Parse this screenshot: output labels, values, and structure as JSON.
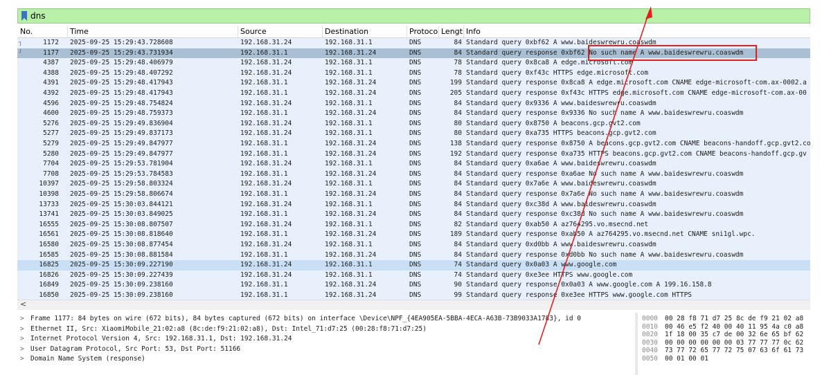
{
  "filter": {
    "value": "dns",
    "icon": "bookmark-icon",
    "bg_color": "#b8f0a8"
  },
  "columns": {
    "no": "No.",
    "time": "Time",
    "source": "Source",
    "destination": "Destination",
    "protocol": "Protoco",
    "length": "Lengt",
    "info": "Info"
  },
  "packets": [
    {
      "no": "1172",
      "time": "2025-09-25 15:29:43.728608",
      "src": "192.168.31.24",
      "dst": "192.168.31.1",
      "proto": "DNS",
      "len": "84",
      "info": "Standard query 0xbf62 A www.baideswrewru.coaswdm"
    },
    {
      "no": "1177",
      "time": "2025-09-25 15:29:43.731934",
      "src": "192.168.31.1",
      "dst": "192.168.31.24",
      "proto": "DNS",
      "len": "84",
      "info": "Standard query response 0xbf62 No such name A www.baideswrewru.coaswdm"
    },
    {
      "no": "4387",
      "time": "2025-09-25 15:29:48.406979",
      "src": "192.168.31.24",
      "dst": "192.168.31.1",
      "proto": "DNS",
      "len": "78",
      "info": "Standard query 0x8ca8 A edge.microsoft.com"
    },
    {
      "no": "4388",
      "time": "2025-09-25 15:29:48.407292",
      "src": "192.168.31.24",
      "dst": "192.168.31.1",
      "proto": "DNS",
      "len": "78",
      "info": "Standard query 0xf43c HTTPS edge.microsoft.com"
    },
    {
      "no": "4391",
      "time": "2025-09-25 15:29:48.417943",
      "src": "192.168.31.1",
      "dst": "192.168.31.24",
      "proto": "DNS",
      "len": "199",
      "info": "Standard query response 0x8ca8 A edge.microsoft.com CNAME edge-microsoft-com.ax-0002.a"
    },
    {
      "no": "4392",
      "time": "2025-09-25 15:29:48.417943",
      "src": "192.168.31.1",
      "dst": "192.168.31.24",
      "proto": "DNS",
      "len": "205",
      "info": "Standard query response 0xf43c HTTPS edge.microsoft.com CNAME edge-microsoft-com.ax-00"
    },
    {
      "no": "4596",
      "time": "2025-09-25 15:29:48.754824",
      "src": "192.168.31.24",
      "dst": "192.168.31.1",
      "proto": "DNS",
      "len": "84",
      "info": "Standard query 0x9336 A www.baideswrewru.coaswdm"
    },
    {
      "no": "4600",
      "time": "2025-09-25 15:29:48.759373",
      "src": "192.168.31.1",
      "dst": "192.168.31.24",
      "proto": "DNS",
      "len": "84",
      "info": "Standard query response 0x9336 No such name A www.baideswrewru.coaswdm"
    },
    {
      "no": "5276",
      "time": "2025-09-25 15:29:49.836904",
      "src": "192.168.31.24",
      "dst": "192.168.31.1",
      "proto": "DNS",
      "len": "80",
      "info": "Standard query 0x8750 A beacons.gcp.gvt2.com"
    },
    {
      "no": "5277",
      "time": "2025-09-25 15:29:49.837173",
      "src": "192.168.31.24",
      "dst": "192.168.31.1",
      "proto": "DNS",
      "len": "80",
      "info": "Standard query 0xa735 HTTPS beacons.gcp.gvt2.com"
    },
    {
      "no": "5279",
      "time": "2025-09-25 15:29:49.847977",
      "src": "192.168.31.1",
      "dst": "192.168.31.24",
      "proto": "DNS",
      "len": "138",
      "info": "Standard query response 0x8750 A beacons.gcp.gvt2.com CNAME beacons-handoff.gcp.gvt2.com"
    },
    {
      "no": "5280",
      "time": "2025-09-25 15:29:49.847977",
      "src": "192.168.31.1",
      "dst": "192.168.31.24",
      "proto": "DNS",
      "len": "192",
      "info": "Standard query response 0xa735 HTTPS beacons.gcp.gvt2.com CNAME beacons-handoff.gcp.gv"
    },
    {
      "no": "7704",
      "time": "2025-09-25 15:29:53.781904",
      "src": "192.168.31.24",
      "dst": "192.168.31.1",
      "proto": "DNS",
      "len": "84",
      "info": "Standard query 0xa6ae A www.baideswrewru.coaswdm"
    },
    {
      "no": "7708",
      "time": "2025-09-25 15:29:53.784583",
      "src": "192.168.31.1",
      "dst": "192.168.31.24",
      "proto": "DNS",
      "len": "84",
      "info": "Standard query response 0xa6ae No such name A www.baideswrewru.coaswdm"
    },
    {
      "no": "10397",
      "time": "2025-09-25 15:29:58.803324",
      "src": "192.168.31.24",
      "dst": "192.168.31.1",
      "proto": "DNS",
      "len": "84",
      "info": "Standard query 0x7a6e A www.baideswrewru.coaswdm"
    },
    {
      "no": "10398",
      "time": "2025-09-25 15:29:58.806674",
      "src": "192.168.31.1",
      "dst": "192.168.31.24",
      "proto": "DNS",
      "len": "84",
      "info": "Standard query response 0x7a6e No such name A www.baideswrewru.coaswdm"
    },
    {
      "no": "13733",
      "time": "2025-09-25 15:30:03.844121",
      "src": "192.168.31.24",
      "dst": "192.168.31.1",
      "proto": "DNS",
      "len": "84",
      "info": "Standard query 0xc38d A www.baideswrewru.coaswdm"
    },
    {
      "no": "13741",
      "time": "2025-09-25 15:30:03.849025",
      "src": "192.168.31.1",
      "dst": "192.168.31.24",
      "proto": "DNS",
      "len": "84",
      "info": "Standard query response 0xc38d No such name A www.baideswrewru.coaswdm"
    },
    {
      "no": "16555",
      "time": "2025-09-25 15:30:08.807507",
      "src": "192.168.31.24",
      "dst": "192.168.31.1",
      "proto": "DNS",
      "len": "82",
      "info": "Standard query 0xab50 A az764295.vo.msecnd.net"
    },
    {
      "no": "16561",
      "time": "2025-09-25 15:30:08.818640",
      "src": "192.168.31.1",
      "dst": "192.168.31.24",
      "proto": "DNS",
      "len": "189",
      "info": "Standard query response 0xab50 A az764295.vo.msecnd.net CNAME sni1gl.wpc."
    },
    {
      "no": "16580",
      "time": "2025-09-25 15:30:08.877454",
      "src": "192.168.31.24",
      "dst": "192.168.31.1",
      "proto": "DNS",
      "len": "84",
      "info": "Standard query 0xd0bb A www.baideswrewru.coaswdm"
    },
    {
      "no": "16585",
      "time": "2025-09-25 15:30:08.881584",
      "src": "192.168.31.1",
      "dst": "192.168.31.24",
      "proto": "DNS",
      "len": "84",
      "info": "Standard query response 0xd0bb No such name A www.baideswrewru.coaswdm"
    },
    {
      "no": "16825",
      "time": "2025-09-25 15:30:09.227190",
      "src": "192.168.31.24",
      "dst": "192.168.31.1",
      "proto": "DNS",
      "len": "74",
      "info": "Standard query 0x0a03 A www.google.com"
    },
    {
      "no": "16826",
      "time": "2025-09-25 15:30:09.227439",
      "src": "192.168.31.24",
      "dst": "192.168.31.1",
      "proto": "DNS",
      "len": "74",
      "info": "Standard query 0xe3ee HTTPS www.google.com"
    },
    {
      "no": "16849",
      "time": "2025-09-25 15:30:09.238160",
      "src": "192.168.31.1",
      "dst": "192.168.31.24",
      "proto": "DNS",
      "len": "90",
      "info": "Standard query response 0x0a03 A www.google.com A 199.16.158.8"
    },
    {
      "no": "16850",
      "time": "2025-09-25 15:30:09.238160",
      "src": "192.168.31.1",
      "dst": "192.168.31.24",
      "proto": "DNS",
      "len": "99",
      "info": "Standard query response 0xe3ee HTTPS www.google.com HTTPS"
    }
  ],
  "details": [
    "Frame 1177: 84 bytes on wire (672 bits), 84 bytes captured (672 bits) on interface \\Device\\NPF_{4EA905EA-5BBA-4ECA-A63B-73B9033A1783}, id 0",
    "Ethernet II, Src: XiaomiMobile_21:02:a8 (8c:de:f9:21:02:a8), Dst: Intel_71:d7:25 (00:28:f8:71:d7:25)",
    "Internet Protocol Version 4, Src: 192.168.31.1, Dst: 192.168.31.24",
    "User Datagram Protocol, Src Port: 53, Dst Port: 51166",
    "Domain Name System (response)"
  ],
  "bytes": [
    {
      "offset": "0000",
      "hex": "00 28 f8 71 d7 25 8c de  f9 21 02 a8"
    },
    {
      "offset": "0010",
      "hex": "00 46 e5 f2 40 00 40 11  95 4a c0 a8"
    },
    {
      "offset": "0020",
      "hex": "1f 18 00 35 c7 de 00 32  6e 65 bf 62"
    },
    {
      "offset": "0030",
      "hex": "00 00 00 00 00 00 03 77  77 77 0c 62"
    },
    {
      "offset": "0040",
      "hex": "73 77 72 65 77 72 75 07  63 6f 61 73"
    },
    {
      "offset": "0050",
      "hex": "00 01 00 01"
    }
  ],
  "annotation_color": "#e32020"
}
